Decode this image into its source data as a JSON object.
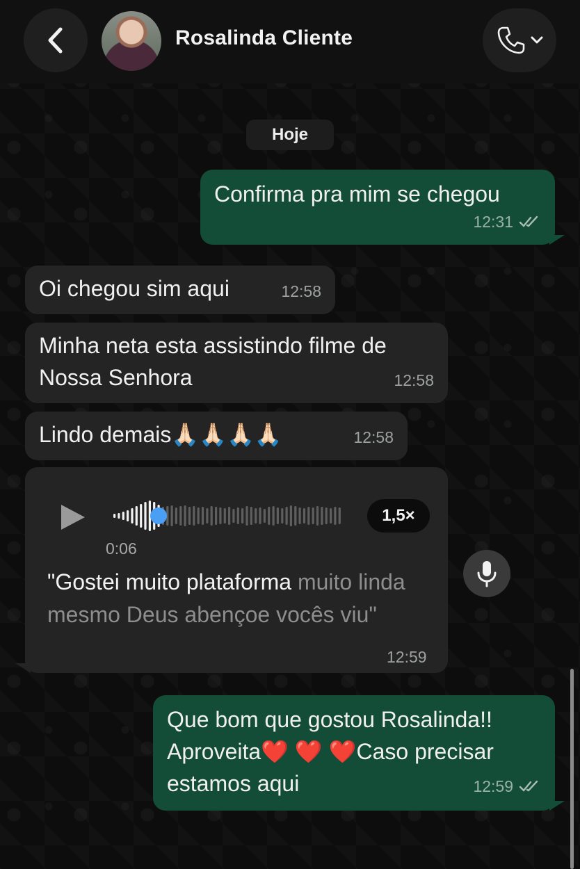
{
  "header": {
    "contact_name": "Rosalinda Cliente",
    "back_icon": "chevron-left-icon",
    "call_icon": "phone-icon",
    "call_dropdown_icon": "chevron-down-icon"
  },
  "date_chip": "Hoje",
  "messages": [
    {
      "direction": "outgoing",
      "text": "Confirma pra mim se chegou",
      "time": "12:31",
      "status": "read"
    },
    {
      "direction": "incoming",
      "text": "Oi chegou sim aqui",
      "time": "12:58"
    },
    {
      "direction": "incoming",
      "lines": [
        "Minha neta esta assistindo filme de",
        "Nossa Senhora"
      ],
      "time": "12:58"
    },
    {
      "direction": "incoming",
      "text": "Lindo demais",
      "emoji": "🙏🏻🙏🏻🙏🏻🙏🏻",
      "time": "12:58"
    },
    {
      "direction": "incoming",
      "type": "voice",
      "duration": "0:06",
      "speed": "1,5×",
      "progress": 0.2,
      "transcript_heard": "\"Gostei muito plataforma",
      "transcript_rest": " muito linda mesmo Deus abençoe vocês viu\"",
      "time": "12:59"
    },
    {
      "direction": "outgoing",
      "line1": "Que bom que gostou Rosalinda!!",
      "line2_a": "Aproveita",
      "line2_hearts": "❤️ ❤️ ❤️",
      "line2_b": "Caso precisar",
      "line3": "estamos aqui",
      "time": "12:59",
      "status": "read"
    }
  ],
  "colors": {
    "outgoing_bubble": "#144d37",
    "incoming_bubble": "#242424",
    "voice_progress": "#4a9ff5"
  }
}
